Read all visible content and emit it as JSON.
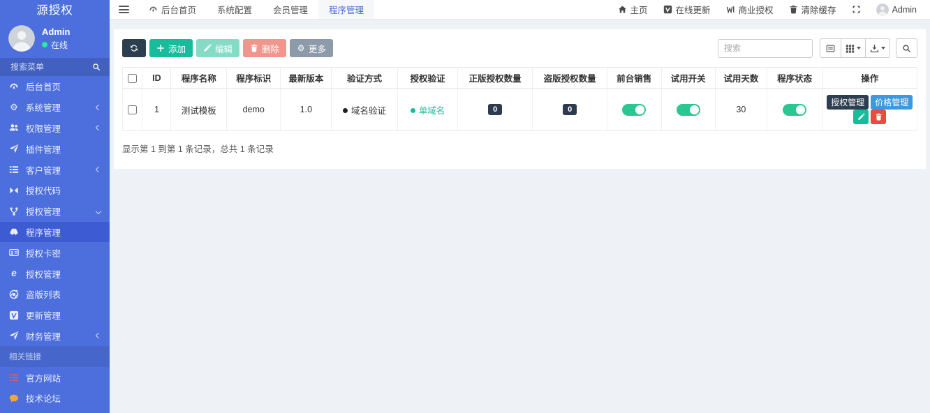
{
  "colors": {
    "sidebar": "#4c6fdd",
    "sidebar-active": "#3d5cd4",
    "navbar-active-link": "#4a6bd8",
    "green": "#18bc9c",
    "green-disabled": "#85dcc6",
    "red": "#e74c3c",
    "red-disabled": "#f0968c",
    "navy": "#2c3e50",
    "blue": "#3b99e0",
    "gray-btn": "#8c9aa9",
    "toggle-green": "#2bc793",
    "online-dot": "#2ee6a8"
  },
  "sidebar": {
    "title": "源授权",
    "user": {
      "name": "Admin",
      "status": "在线",
      "avatar_icon": "user-avatar-icon"
    },
    "search": {
      "placeholder": "搜索菜单",
      "icon": "search-icon"
    },
    "menu": [
      {
        "key": "dashboard",
        "label": "后台首页",
        "icon": "dashboard-icon"
      },
      {
        "key": "system",
        "label": "系统管理",
        "icon": "gears-icon",
        "chevron": "left"
      },
      {
        "key": "permission",
        "label": "权限管理",
        "icon": "users-icon",
        "chevron": "left"
      },
      {
        "key": "plugin",
        "label": "插件管理",
        "icon": "paper-plane-icon"
      },
      {
        "key": "customer",
        "label": "客户管理",
        "icon": "list-icon",
        "chevron": "left"
      },
      {
        "key": "auth-code",
        "label": "授权代码",
        "icon": "code-icon"
      },
      {
        "key": "auth-manage",
        "label": "授权管理",
        "icon": "fork-icon",
        "chevron": "down"
      },
      {
        "key": "program-manage",
        "label": "程序管理",
        "icon": "car-icon",
        "active": true
      },
      {
        "key": "auth-card",
        "label": "授权卡密",
        "icon": "id-card-icon"
      },
      {
        "key": "auth-manage-sub",
        "label": "授权管理",
        "icon": "edge-icon"
      },
      {
        "key": "pirate-list",
        "label": "盗版列表",
        "icon": "chrome-icon"
      },
      {
        "key": "update-manage",
        "label": "更新管理",
        "icon": "vimeo-icon"
      },
      {
        "key": "finance",
        "label": "财务管理",
        "icon": "paper-plane-icon",
        "chevron": "left"
      },
      {
        "key": "related-links",
        "label": "相关链接",
        "section": true
      },
      {
        "key": "official-site",
        "label": "官方网站",
        "icon": "red-list-icon"
      },
      {
        "key": "tech-forum",
        "label": "技术论坛",
        "icon": "comment-icon"
      }
    ]
  },
  "topbar": {
    "hamburger_icon": "hamburger-icon",
    "tabs": [
      {
        "key": "dashboard",
        "label": "后台首页",
        "icon": "dashboard-icon"
      },
      {
        "key": "system-config",
        "label": "系统配置"
      },
      {
        "key": "member-manage",
        "label": "会员管理"
      },
      {
        "key": "program-manage",
        "label": "程序管理",
        "active": true
      }
    ],
    "right": [
      {
        "key": "home",
        "label": "主页",
        "icon": "home-icon"
      },
      {
        "key": "online-update",
        "label": "在线更新",
        "icon": "vimeo-icon"
      },
      {
        "key": "commercial-auth",
        "label": "商业授权",
        "icon": "weibo-icon"
      },
      {
        "key": "clear-cache",
        "label": "清除缓存",
        "icon": "trash-icon"
      },
      {
        "key": "fullscreen",
        "label": "",
        "icon": "expand-icon"
      },
      {
        "key": "user",
        "label": "Admin",
        "icon": "user-avatar-icon"
      }
    ]
  },
  "toolbar": {
    "buttons": [
      {
        "key": "refresh",
        "label": "",
        "icon": "refresh-icon",
        "style": "navy"
      },
      {
        "key": "add",
        "label": "添加",
        "icon": "plus-icon",
        "style": "green"
      },
      {
        "key": "edit",
        "label": "编辑",
        "icon": "pencil-icon",
        "style": "green-disabled"
      },
      {
        "key": "delete",
        "label": "删除",
        "icon": "trash-icon",
        "style": "red-disabled"
      },
      {
        "key": "more",
        "label": "更多",
        "icon": "gear-icon",
        "style": "gray"
      }
    ],
    "search_placeholder": "搜索",
    "view_buttons": [
      {
        "key": "paging",
        "icon": "paging-icon",
        "caret": false
      },
      {
        "key": "columns",
        "icon": "columns-icon",
        "caret": true
      },
      {
        "key": "export",
        "icon": "export-icon",
        "caret": true
      }
    ],
    "search_button_icon": "search-icon"
  },
  "table": {
    "columns": [
      "ID",
      "程序名称",
      "程序标识",
      "最新版本",
      "验证方式",
      "授权验证",
      "正版授权数量",
      "盗版授权数量",
      "前台销售",
      "试用开关",
      "试用天数",
      "程序状态",
      "操作"
    ],
    "rows": [
      {
        "id": "1",
        "name": "测试模板",
        "code": "demo",
        "version": "1.0",
        "verify_method": "域名验证",
        "auth_verify": "单域名",
        "genuine_count": "0",
        "pirated_count": "0",
        "front_sale": true,
        "trial_switch": true,
        "trial_days": "30",
        "status": true,
        "actions": [
          {
            "key": "auth-manage",
            "label": "授权管理",
            "style": "navy"
          },
          {
            "key": "price-manage",
            "label": "价格管理",
            "style": "blue"
          },
          {
            "key": "edit",
            "label": "",
            "icon": "pencil-icon",
            "style": "green"
          },
          {
            "key": "delete",
            "label": "",
            "icon": "trash-icon",
            "style": "red"
          }
        ]
      }
    ],
    "summary": "显示第 1 到第 1 条记录，总共 1 条记录"
  }
}
